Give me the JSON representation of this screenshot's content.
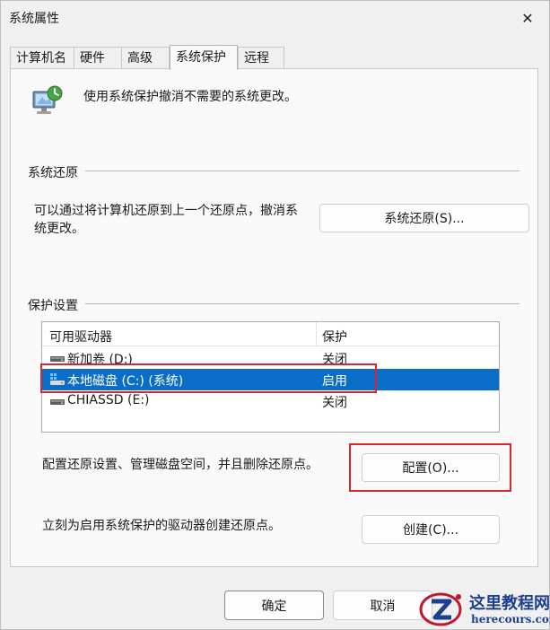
{
  "window": {
    "title": "系统属性",
    "close_glyph": "✕"
  },
  "tabs": [
    {
      "label": "计算机名",
      "active": false
    },
    {
      "label": "硬件",
      "active": false
    },
    {
      "label": "高级",
      "active": false
    },
    {
      "label": "系统保护",
      "active": true
    },
    {
      "label": "远程",
      "active": false
    }
  ],
  "intro": {
    "text": "使用系统保护撤消不需要的系统更改。",
    "icon": "computer-shield-icon"
  },
  "restore": {
    "heading": "系统还原",
    "description_line1": "可以通过将计算机还原到上一个还原点，撤消系",
    "description_line2": "统更改。",
    "button_label": "系统还原(S)..."
  },
  "protection": {
    "heading": "保护设置",
    "columns": [
      "可用驱动器",
      "保护"
    ],
    "drives": [
      {
        "name": "新加卷 (D:)",
        "status": "关闭",
        "selected": false,
        "icon": "drive-icon"
      },
      {
        "name": "本地磁盘 (C:) (系统)",
        "status": "启用",
        "selected": true,
        "icon": "system-drive-icon"
      },
      {
        "name": "CHIASSD (E:)",
        "status": "关闭",
        "selected": false,
        "icon": "drive-icon"
      }
    ],
    "configure_text": "配置还原设置、管理磁盘空间，并且删除还原点。",
    "configure_button": "配置(O)...",
    "create_text": "立刻为启用系统保护的驱动器创建还原点。",
    "create_button": "创建(C)..."
  },
  "footer": {
    "ok_label": "确定",
    "cancel_label": "取消"
  },
  "watermark": {
    "title": "这里教程网",
    "url": "herecours.com"
  },
  "colors": {
    "selection": "#0a6ec8",
    "highlight_box": "#d6262e"
  }
}
